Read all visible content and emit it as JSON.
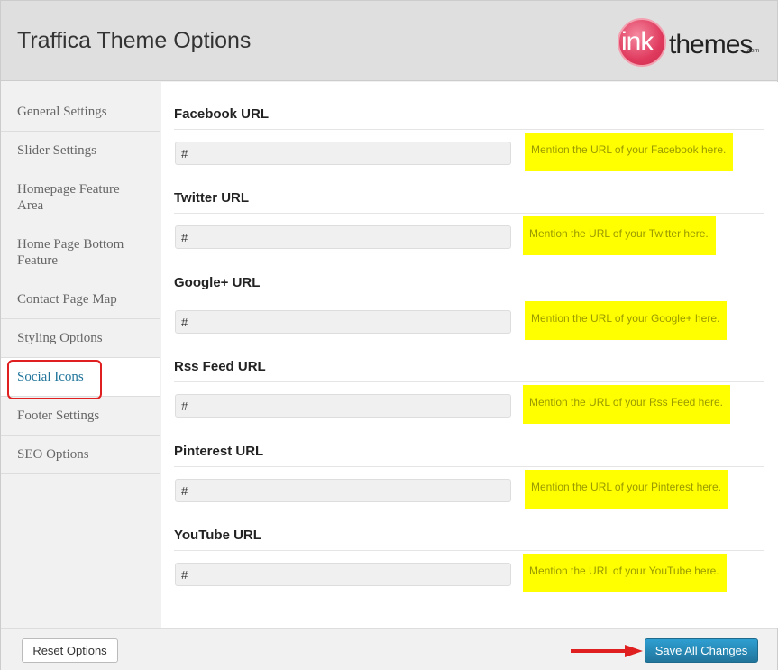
{
  "header": {
    "title": "Traffica Theme Options",
    "logo_text": "inkthemes.com"
  },
  "sidebar": {
    "items": [
      {
        "label": "General Settings"
      },
      {
        "label": "Slider Settings"
      },
      {
        "label": "Homepage Feature Area"
      },
      {
        "label": "Home Page Bottom Feature"
      },
      {
        "label": "Contact Page Map"
      },
      {
        "label": "Styling Options"
      },
      {
        "label": "Social Icons",
        "active": true
      },
      {
        "label": "Footer Settings"
      },
      {
        "label": "SEO Options"
      }
    ]
  },
  "main": {
    "fields": [
      {
        "label": "Facebook URL",
        "value": "#",
        "help": "Mention the URL of your Facebook here."
      },
      {
        "label": "Twitter URL",
        "value": "#",
        "help": "Mention the URL of your Twitter here."
      },
      {
        "label": "Google+ URL",
        "value": "#",
        "help": "Mention the URL of your Google+ here."
      },
      {
        "label": "Rss Feed URL",
        "value": "#",
        "help": "Mention the URL of your Rss Feed here."
      },
      {
        "label": "Pinterest URL",
        "value": "#",
        "help": "Mention the URL of your Pinterest here."
      },
      {
        "label": "YouTube URL",
        "value": "#",
        "help": "Mention the URL of your YouTube here."
      }
    ]
  },
  "footer": {
    "reset_label": "Reset Options",
    "save_label": "Save All Changes"
  },
  "colors": {
    "accent": "#21759b",
    "help_bg": "#ffff00",
    "highlight": "#e02020"
  }
}
